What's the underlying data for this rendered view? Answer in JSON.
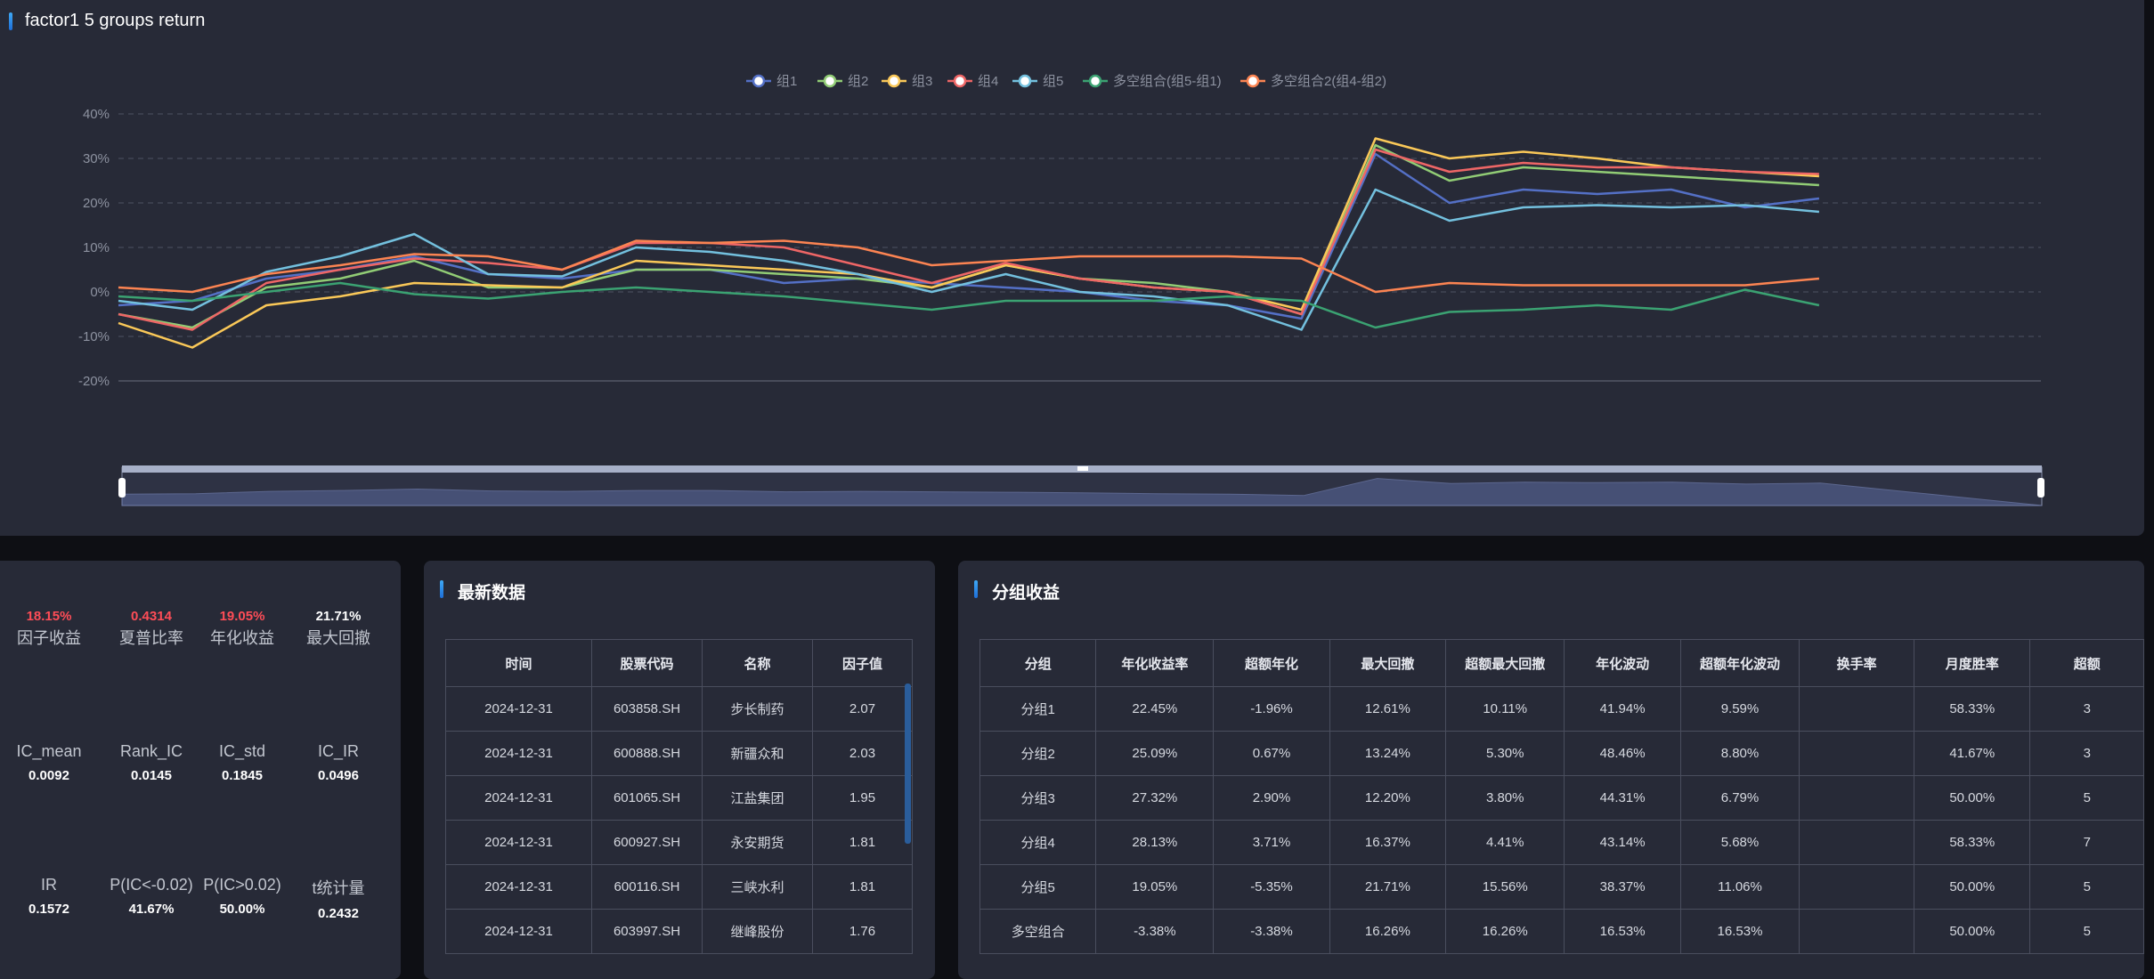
{
  "chart": {
    "title": "factor1 5 groups return",
    "legend": [
      {
        "name": "组1",
        "color": "#5470c6"
      },
      {
        "name": "组2",
        "color": "#91cc75"
      },
      {
        "name": "组3",
        "color": "#fac858"
      },
      {
        "name": "组4",
        "color": "#ee6666"
      },
      {
        "name": "组5",
        "color": "#73c0de"
      },
      {
        "name": "多空组合(组5-组1)",
        "color": "#3ba272"
      },
      {
        "name": "多空组合2(组4-组2)",
        "color": "#fc8452"
      }
    ],
    "y_ticks": [
      "40%",
      "30%",
      "20%",
      "10%",
      "0%",
      "-10%",
      "-20%"
    ]
  },
  "chart_data": {
    "type": "line",
    "title": "factor1 5 groups return",
    "xlabel": "",
    "ylabel": "",
    "ylim": [
      -20,
      40
    ],
    "grid": true,
    "legend_position": "top-center",
    "x": [
      1,
      2,
      3,
      4,
      5,
      6,
      7,
      8,
      9,
      10,
      11,
      12,
      13,
      14,
      15,
      16,
      17,
      18,
      19,
      20,
      21,
      22,
      23,
      24,
      25,
      26,
      27
    ],
    "series": [
      {
        "name": "组1",
        "color": "#5470c6",
        "values": [
          -3,
          -2,
          3,
          5,
          8,
          4,
          3,
          5,
          5,
          2,
          3,
          2,
          1,
          0,
          -2,
          -3,
          -6,
          31,
          20,
          23,
          22,
          23,
          19,
          21,
          null,
          null,
          null
        ]
      },
      {
        "name": "组2",
        "color": "#91cc75",
        "values": [
          -5,
          -8,
          1,
          3,
          7,
          1,
          1,
          5,
          5,
          4,
          3,
          1,
          6,
          3,
          2,
          0,
          -5,
          33,
          25,
          28,
          27,
          26,
          25,
          24,
          null,
          null,
          null
        ]
      },
      {
        "name": "组3",
        "color": "#fac858",
        "values": [
          -7,
          -12.5,
          -3,
          -1,
          2,
          1.5,
          1,
          7,
          6,
          5,
          4,
          1,
          6,
          3,
          1,
          0,
          -4,
          34.5,
          30,
          31.5,
          30,
          28,
          27,
          26,
          null,
          null,
          null
        ]
      },
      {
        "name": "组4",
        "color": "#ee6666",
        "values": [
          -5,
          -8.5,
          2,
          5,
          7.5,
          6.5,
          5,
          11,
          11,
          10,
          6,
          2,
          6.5,
          3,
          1,
          0,
          -5,
          32,
          27,
          29,
          28,
          28,
          27,
          26.5,
          null,
          null,
          null
        ]
      },
      {
        "name": "组5",
        "color": "#73c0de",
        "values": [
          -2,
          -4,
          4.5,
          8,
          13,
          4,
          3.5,
          10,
          9,
          7,
          4,
          0,
          4,
          0,
          -1,
          -3,
          -8.5,
          23,
          16,
          19,
          19.5,
          19,
          19.5,
          18,
          null,
          null,
          null
        ]
      },
      {
        "name": "多空组合(组5-组1)",
        "color": "#3ba272",
        "values": [
          -1,
          -2,
          0,
          2,
          -0.5,
          -1.5,
          0,
          1,
          0,
          -1,
          -2.5,
          -4,
          -2,
          -2,
          -2,
          -1,
          -2,
          -8,
          -4.5,
          -4,
          -3,
          -4,
          0.5,
          -3,
          null,
          null,
          null
        ]
      },
      {
        "name": "多空组合2(组4-组2)",
        "color": "#fc8452",
        "values": [
          1,
          0,
          4,
          6,
          8.5,
          8,
          5,
          11.5,
          11,
          11.5,
          10,
          6,
          7,
          8,
          8,
          8,
          7.5,
          0,
          2,
          1.5,
          1.5,
          1.5,
          1.5,
          3,
          null,
          null,
          null
        ]
      }
    ]
  },
  "metrics": [
    {
      "value": "18.15%",
      "label": "因子收益",
      "red": true
    },
    {
      "value": "0.4314",
      "label": "夏普比率",
      "red": true
    },
    {
      "value": "19.05%",
      "label": "年化收益",
      "red": true
    },
    {
      "value": "21.71%",
      "label": "最大回撤",
      "red": false
    },
    {
      "value": "0.0092",
      "label": "IC_mean",
      "red": false
    },
    {
      "value": "0.0145",
      "label": "Rank_IC",
      "red": false
    },
    {
      "value": "0.1845",
      "label": "IC_std",
      "red": false
    },
    {
      "value": "0.0496",
      "label": "IC_IR",
      "red": false
    },
    {
      "value": "0.1572",
      "label": "IR",
      "red": false
    },
    {
      "value": "41.67%",
      "label": "P(IC<-0.02)",
      "red": false
    },
    {
      "value": "50.00%",
      "label": "P(IC>0.02)",
      "red": false
    },
    {
      "value": "0.2432",
      "label": "t统计量",
      "red": false
    }
  ],
  "latest": {
    "title": "最新数据",
    "columns": [
      "时间",
      "股票代码",
      "名称",
      "因子值"
    ],
    "rows": [
      [
        "2024-12-31",
        "603858.SH",
        "步长制药",
        "2.07"
      ],
      [
        "2024-12-31",
        "600888.SH",
        "新疆众和",
        "2.03"
      ],
      [
        "2024-12-31",
        "601065.SH",
        "江盐集团",
        "1.95"
      ],
      [
        "2024-12-31",
        "600927.SH",
        "永安期货",
        "1.81"
      ],
      [
        "2024-12-31",
        "600116.SH",
        "三峡水利",
        "1.81"
      ],
      [
        "2024-12-31",
        "603997.SH",
        "继峰股份",
        "1.76"
      ]
    ]
  },
  "groups": {
    "title": "分组收益",
    "columns": [
      "分组",
      "年化收益率",
      "超额年化",
      "最大回撤",
      "超额最大回撤",
      "年化波动",
      "超额年化波动",
      "换手率",
      "月度胜率",
      "超额"
    ],
    "rows": [
      [
        "分组1",
        "22.45%",
        "-1.96%",
        "12.61%",
        "10.11%",
        "41.94%",
        "9.59%",
        "",
        "58.33%",
        "3"
      ],
      [
        "分组2",
        "25.09%",
        "0.67%",
        "13.24%",
        "5.30%",
        "48.46%",
        "8.80%",
        "",
        "41.67%",
        "3"
      ],
      [
        "分组3",
        "27.32%",
        "2.90%",
        "12.20%",
        "3.80%",
        "44.31%",
        "6.79%",
        "",
        "50.00%",
        "5"
      ],
      [
        "分组4",
        "28.13%",
        "3.71%",
        "16.37%",
        "4.41%",
        "43.14%",
        "5.68%",
        "",
        "58.33%",
        "7"
      ],
      [
        "分组5",
        "19.05%",
        "-5.35%",
        "21.71%",
        "15.56%",
        "38.37%",
        "11.06%",
        "",
        "50.00%",
        "5"
      ],
      [
        "多空组合",
        "-3.38%",
        "-3.38%",
        "16.26%",
        "16.26%",
        "16.53%",
        "16.53%",
        "",
        "50.00%",
        "5"
      ]
    ]
  }
}
